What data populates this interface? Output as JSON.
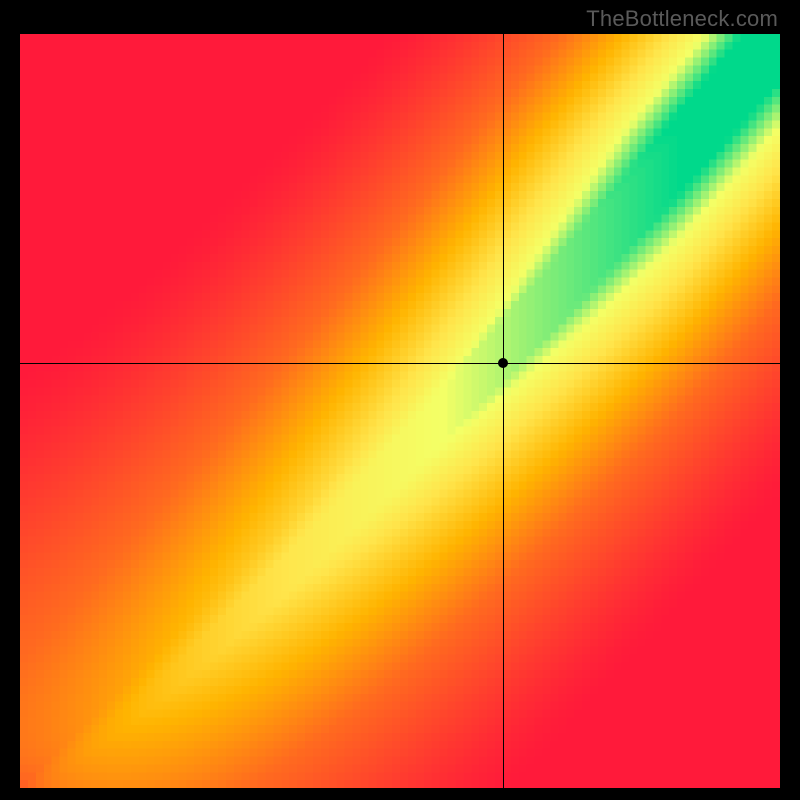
{
  "watermark": "TheBottleneck.com",
  "chart_data": {
    "type": "heatmap",
    "title": "",
    "xlabel": "",
    "ylabel": "",
    "xlim": [
      0,
      1
    ],
    "ylim": [
      0,
      1
    ],
    "crosshair": {
      "x": 0.635,
      "y": 0.563
    },
    "marker": {
      "x": 0.635,
      "y": 0.563
    },
    "diagonal_band": {
      "note": "green optimal band along y ≈ x^1.2 with half-width growing from 0 to ~0.06",
      "center_exponent": 1.2,
      "halfwidth_at_x1": 0.06
    },
    "colorscale": [
      {
        "stop": 0.0,
        "color": "#ff1a3a"
      },
      {
        "stop": 0.35,
        "color": "#ff6a1f"
      },
      {
        "stop": 0.55,
        "color": "#ffb400"
      },
      {
        "stop": 0.72,
        "color": "#ffe44a"
      },
      {
        "stop": 0.85,
        "color": "#f4ff66"
      },
      {
        "stop": 1.0,
        "color": "#00d98b"
      }
    ],
    "grid_resolution": 96
  }
}
